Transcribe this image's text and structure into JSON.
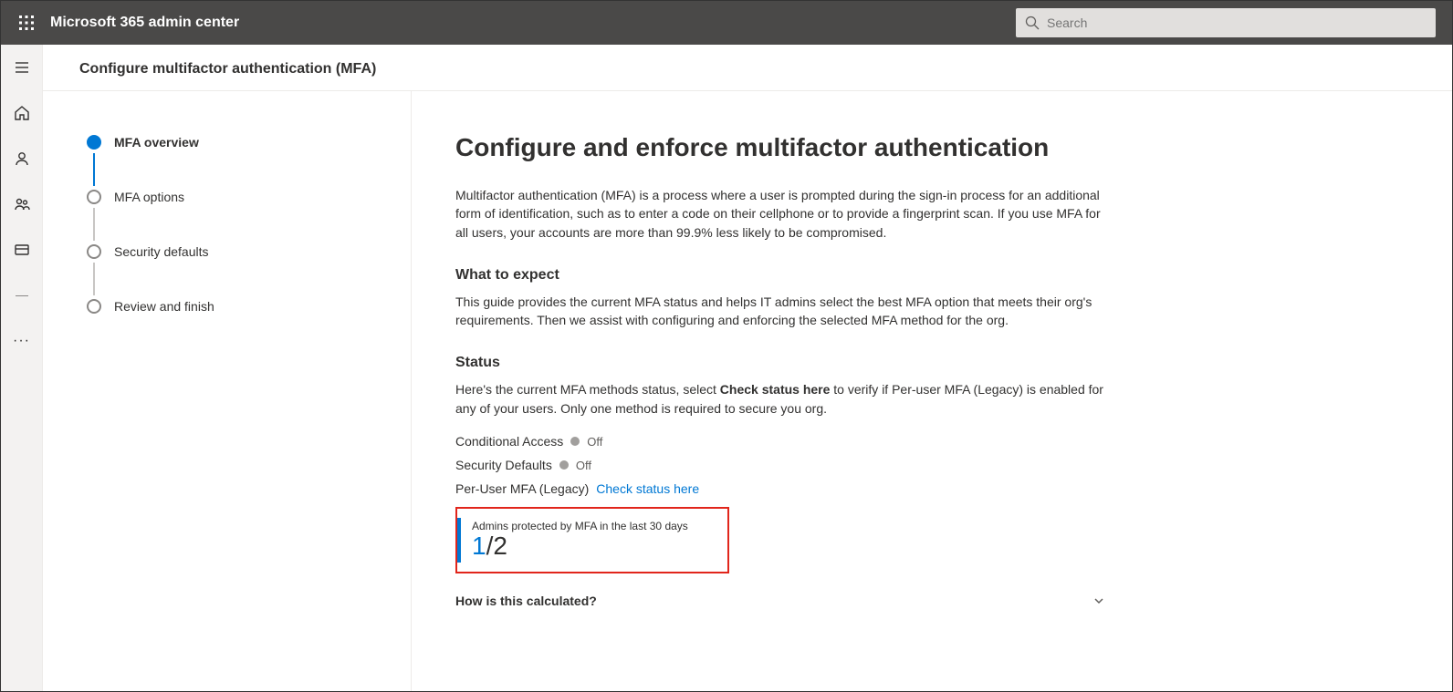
{
  "header": {
    "app_title": "Microsoft 365 admin center",
    "search_placeholder": "Search"
  },
  "page": {
    "title": "Configure multifactor authentication (MFA)"
  },
  "wizard": {
    "steps": [
      {
        "label": "MFA overview",
        "active": true
      },
      {
        "label": "MFA options"
      },
      {
        "label": "Security defaults"
      },
      {
        "label": "Review and finish"
      }
    ]
  },
  "detail": {
    "heading": "Configure and enforce multifactor authentication",
    "intro": "Multifactor authentication (MFA) is a process where a user is prompted during the sign-in process for an additional form of identification, such as to enter a code on their cellphone or to provide a fingerprint scan. If you use MFA for all users, your accounts are more than 99.9% less likely to be compromised.",
    "expect_heading": "What to expect",
    "expect_body": "This guide provides the current MFA status and helps IT admins select the best MFA option that meets their org's requirements. Then we assist with configuring and enforcing the selected MFA method for the org.",
    "status_heading": "Status",
    "status_intro_pre": "Here's the current MFA methods status, select ",
    "status_intro_bold": "Check status here",
    "status_intro_post": " to verify if Per-user MFA (Legacy) is enabled for any of your users. Only one method is required to secure you org.",
    "items": {
      "conditional_access": {
        "label": "Conditional Access",
        "value": "Off"
      },
      "security_defaults": {
        "label": "Security Defaults",
        "value": "Off"
      },
      "per_user": {
        "label": "Per-User MFA (Legacy)",
        "link": "Check status here"
      }
    },
    "callout": {
      "caption": "Admins protected by MFA in the last 30 days",
      "numerator": "1",
      "denominator_text": "/2"
    },
    "accordion_label": "How is this calculated?"
  }
}
